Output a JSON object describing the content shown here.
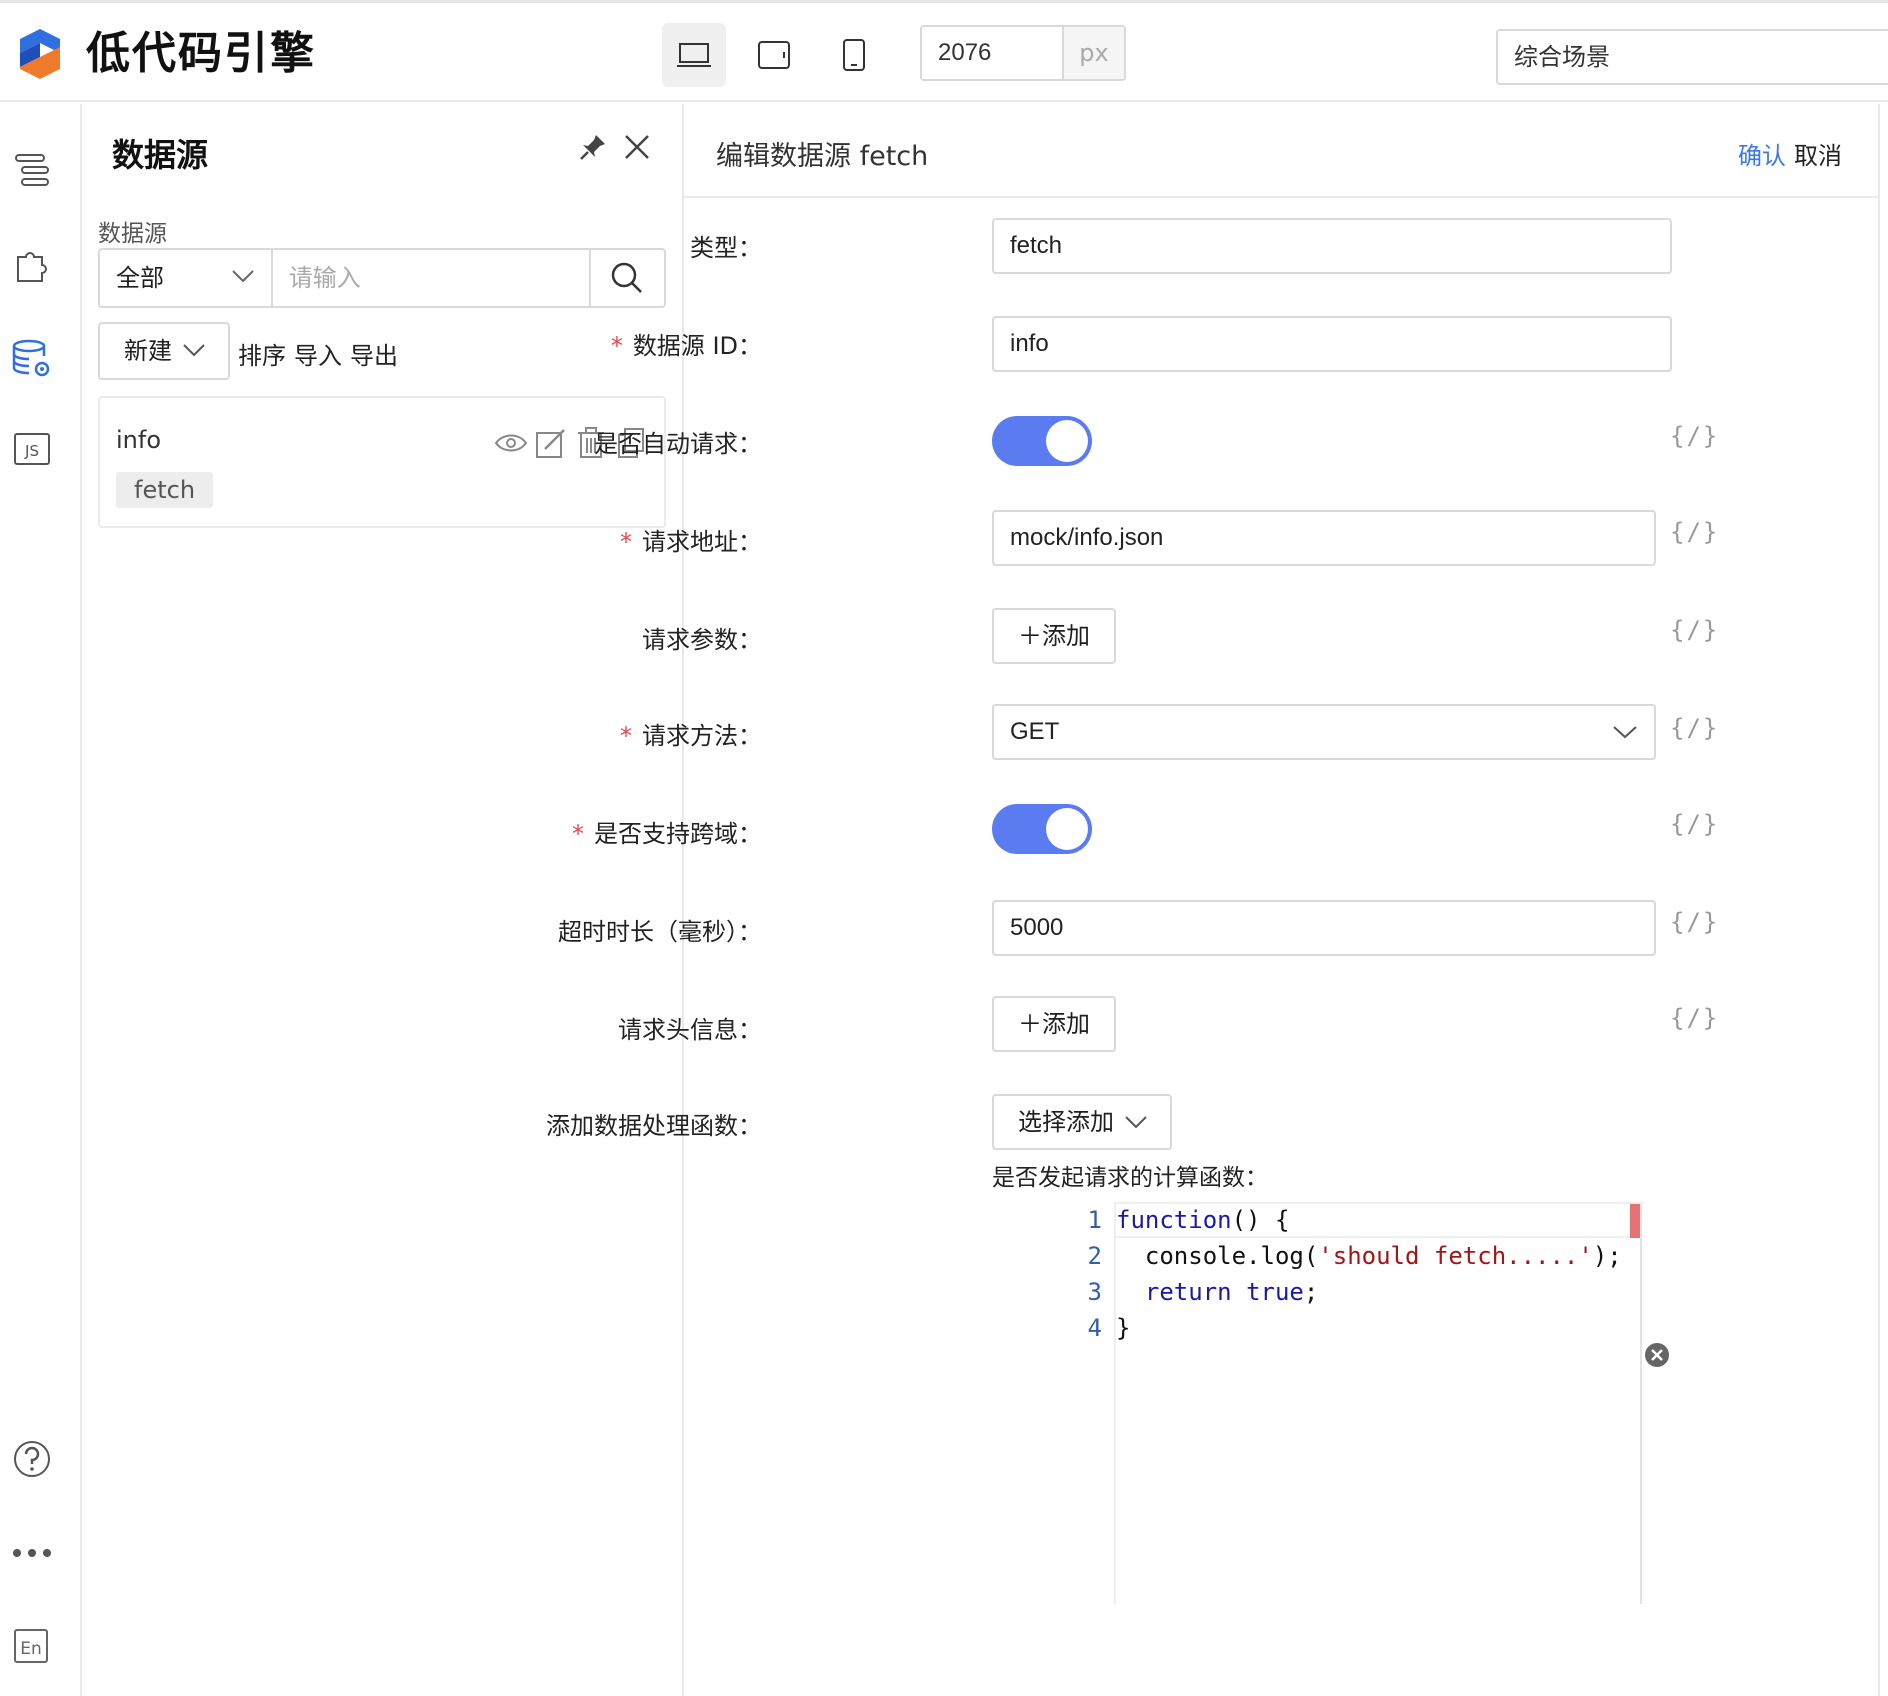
{
  "app": {
    "title": "低代码引擎",
    "width_value": "2076",
    "width_unit": "px",
    "scene": "综合场景"
  },
  "devices": [
    "desktop-icon",
    "tablet-icon",
    "phone-icon"
  ],
  "rail": {
    "icons": [
      "outline-tree-icon",
      "component-puzzle-icon",
      "datasource-icon",
      "js-icon",
      "help-icon",
      "more-icon",
      "language-en-icon"
    ],
    "en_label": "En",
    "js_label": "JS"
  },
  "datasource_panel": {
    "title": "数据源",
    "filter_label": "数据源",
    "filter_type": "全部",
    "search_placeholder": "请输入",
    "new_label": "新建",
    "actions": [
      "排序",
      "导入",
      "导出"
    ],
    "items": [
      {
        "name": "info",
        "type": "fetch"
      }
    ]
  },
  "editor": {
    "title": "编辑数据源 fetch",
    "confirm": "确认",
    "cancel": "取消",
    "fields": {
      "type": {
        "label": "类型：",
        "value": "fetch"
      },
      "id": {
        "label": "数据源 ID：",
        "value": "info",
        "required": true
      },
      "auto_request": {
        "label": "是否自动请求：",
        "value": true
      },
      "url": {
        "label": "请求地址：",
        "value": "mock/info.json",
        "required": true
      },
      "params": {
        "label": "请求参数：",
        "button": "＋添加"
      },
      "method": {
        "label": "请求方法：",
        "value": "GET",
        "required": true
      },
      "cors": {
        "label": "是否支持跨域：",
        "value": true,
        "required": true
      },
      "timeout": {
        "label": "超时时长（毫秒）：",
        "value": "5000"
      },
      "headers": {
        "label": "请求头信息：",
        "button": "＋添加"
      },
      "handlers": {
        "label": "添加数据处理函数：",
        "button": "选择添加"
      }
    },
    "var_toggle": "{/}",
    "function_label": "是否发起请求的计算函数：",
    "code_line_numbers": [
      "1",
      "2",
      "3",
      "4"
    ]
  },
  "colors": {
    "accent": "#5b7cf0",
    "link": "#3b78e7",
    "required": "#e5484d"
  }
}
